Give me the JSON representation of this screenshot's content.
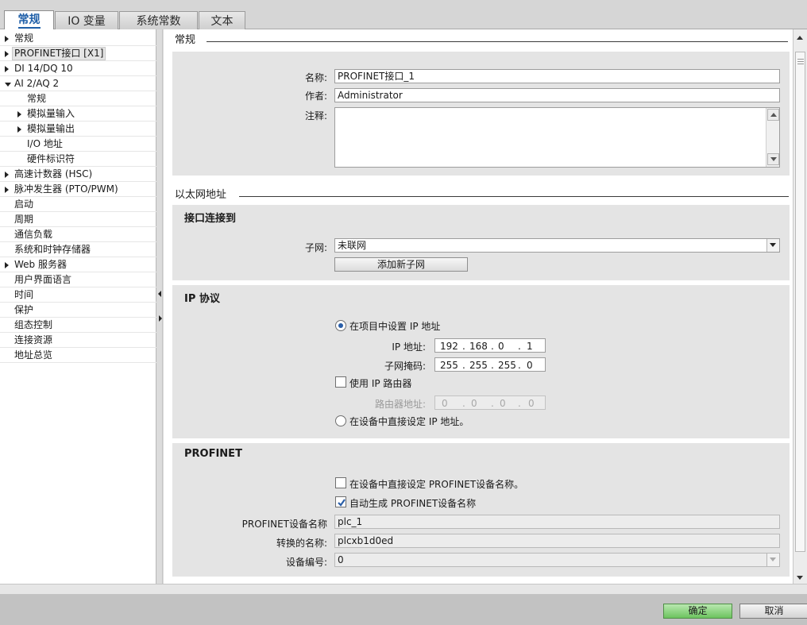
{
  "tabs": [
    {
      "label": "常规",
      "active": true
    },
    {
      "label": "IO 变量",
      "active": false
    },
    {
      "label": "系统常数",
      "active": false
    },
    {
      "label": "文本",
      "active": false
    }
  ],
  "tree": [
    {
      "label": "常规",
      "arrow": "right"
    },
    {
      "label": "PROFINET接口 [X1]",
      "arrow": "right",
      "selected": true
    },
    {
      "label": "DI 14/DQ 10",
      "arrow": "right"
    },
    {
      "label": "AI 2/AQ 2",
      "arrow": "down"
    },
    {
      "label": "常规",
      "arrow": "none"
    },
    {
      "label": "模拟量输入",
      "arrow": "right"
    },
    {
      "label": "模拟量输出",
      "arrow": "right"
    },
    {
      "label": "I/O 地址",
      "arrow": "none"
    },
    {
      "label": "硬件标识符",
      "arrow": "none"
    },
    {
      "label": "高速计数器 (HSC)",
      "arrow": "right"
    },
    {
      "label": "脉冲发生器 (PTO/PWM)",
      "arrow": "right"
    },
    {
      "label": "启动",
      "arrow": "none"
    },
    {
      "label": "周期",
      "arrow": "none"
    },
    {
      "label": "通信负载",
      "arrow": "none"
    },
    {
      "label": "系统和时钟存储器",
      "arrow": "none"
    },
    {
      "label": "Web 服务器",
      "arrow": "right"
    },
    {
      "label": "用户界面语言",
      "arrow": "none"
    },
    {
      "label": "时间",
      "arrow": "none"
    },
    {
      "label": "保护",
      "arrow": "none"
    },
    {
      "label": "组态控制",
      "arrow": "none"
    },
    {
      "label": "连接资源",
      "arrow": "none"
    },
    {
      "label": "地址总览",
      "arrow": "none"
    }
  ],
  "general": {
    "section_title": "常规",
    "name_label": "名称:",
    "name_value": "PROFINET接口_1",
    "author_label": "作者:",
    "author_value": "Administrator",
    "comment_label": "注释:",
    "comment_value": ""
  },
  "ethernet": {
    "section_title": "以太网地址",
    "interface_title": "接口连接到",
    "subnet_label": "子网:",
    "subnet_value": "未联网",
    "add_subnet_button": "添加新子网",
    "ip_title": "IP 协议",
    "set_in_project_label": "在项目中设置 IP 地址",
    "ip_label": "IP 地址:",
    "ip_octets": [
      "192",
      "168",
      "0",
      "1"
    ],
    "mask_label": "子网掩码:",
    "mask_octets": [
      "255",
      "255",
      "255",
      "0"
    ],
    "use_router_label": "使用 IP 路由器",
    "router_label": "路由器地址:",
    "router_octets": [
      "0",
      "0",
      "0",
      "0"
    ],
    "set_on_device_label": "在设备中直接设定 IP 地址。"
  },
  "profinet": {
    "title": "PROFINET",
    "set_name_on_device_label": "在设备中直接设定 PROFINET设备名称。",
    "auto_generate_label": "自动生成 PROFINET设备名称",
    "device_name_label": "PROFINET设备名称",
    "device_name_value": "plc_1",
    "converted_name_label": "转换的名称:",
    "converted_name_value": "plcxb1d0ed",
    "device_number_label": "设备编号:",
    "device_number_value": "0"
  },
  "footer": {
    "ok_label": "确定",
    "cancel_label": "取消"
  }
}
